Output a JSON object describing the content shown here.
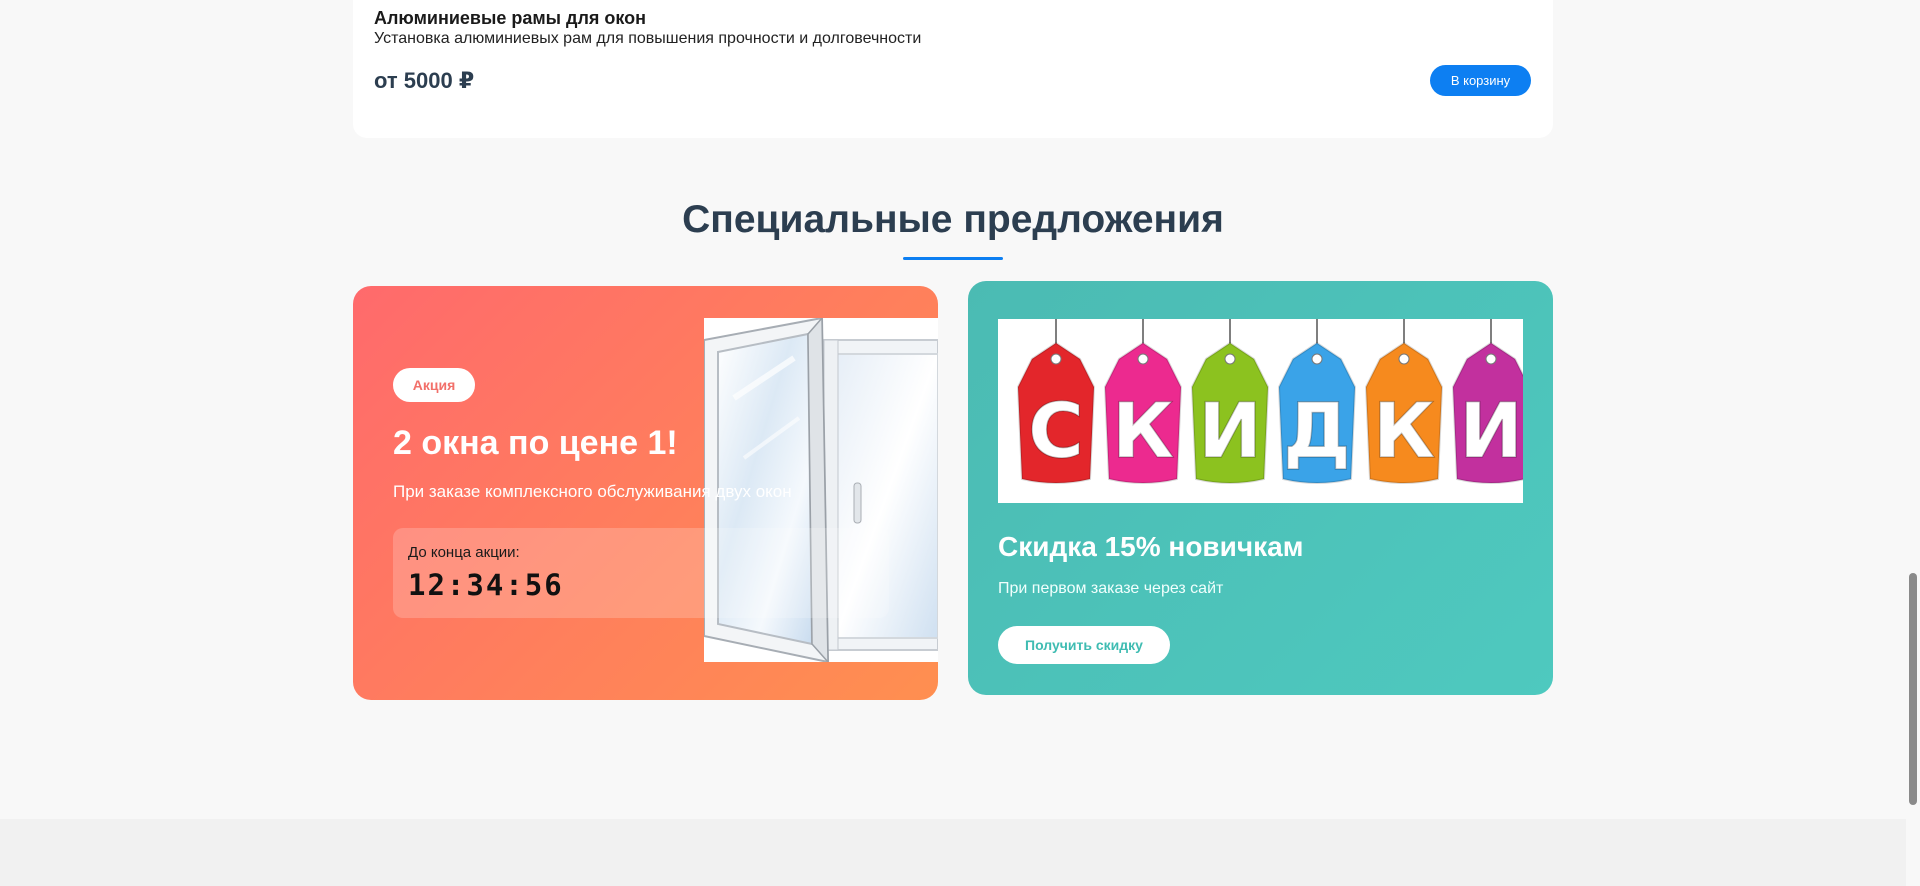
{
  "product": {
    "title": "Алюминиевые рамы для окон",
    "description": "Установка алюминиевых рам для повышения прочности и долговечности",
    "price": "от 5000 ₽",
    "cart_label": "В корзину"
  },
  "specials": {
    "heading": "Специальные предложения",
    "promo": {
      "badge": "Акция",
      "title": "2 окна по цене 1!",
      "description": "При заказе комплексного обслуживания двух окон",
      "timer_label": "До конца акции:",
      "timer_value": "12:34:56"
    },
    "discount": {
      "banner_letters": [
        "С",
        "К",
        "И",
        "Д",
        "К",
        "И"
      ],
      "banner_colors": [
        "#e3262b",
        "#ec2a8f",
        "#8cc21f",
        "#3aa3e8",
        "#f68a1e",
        "#c2309e"
      ],
      "title": "Скидка 15% новичкам",
      "description": "При первом заказе через сайт",
      "button_label": "Получить скидку"
    }
  },
  "colors": {
    "accent": "#0d7ff2",
    "promo_gradient_start": "#ff6a6c",
    "promo_gradient_end": "#ff8f50",
    "discount_bg": "#4ec9bf",
    "heading": "#2c3e50"
  }
}
